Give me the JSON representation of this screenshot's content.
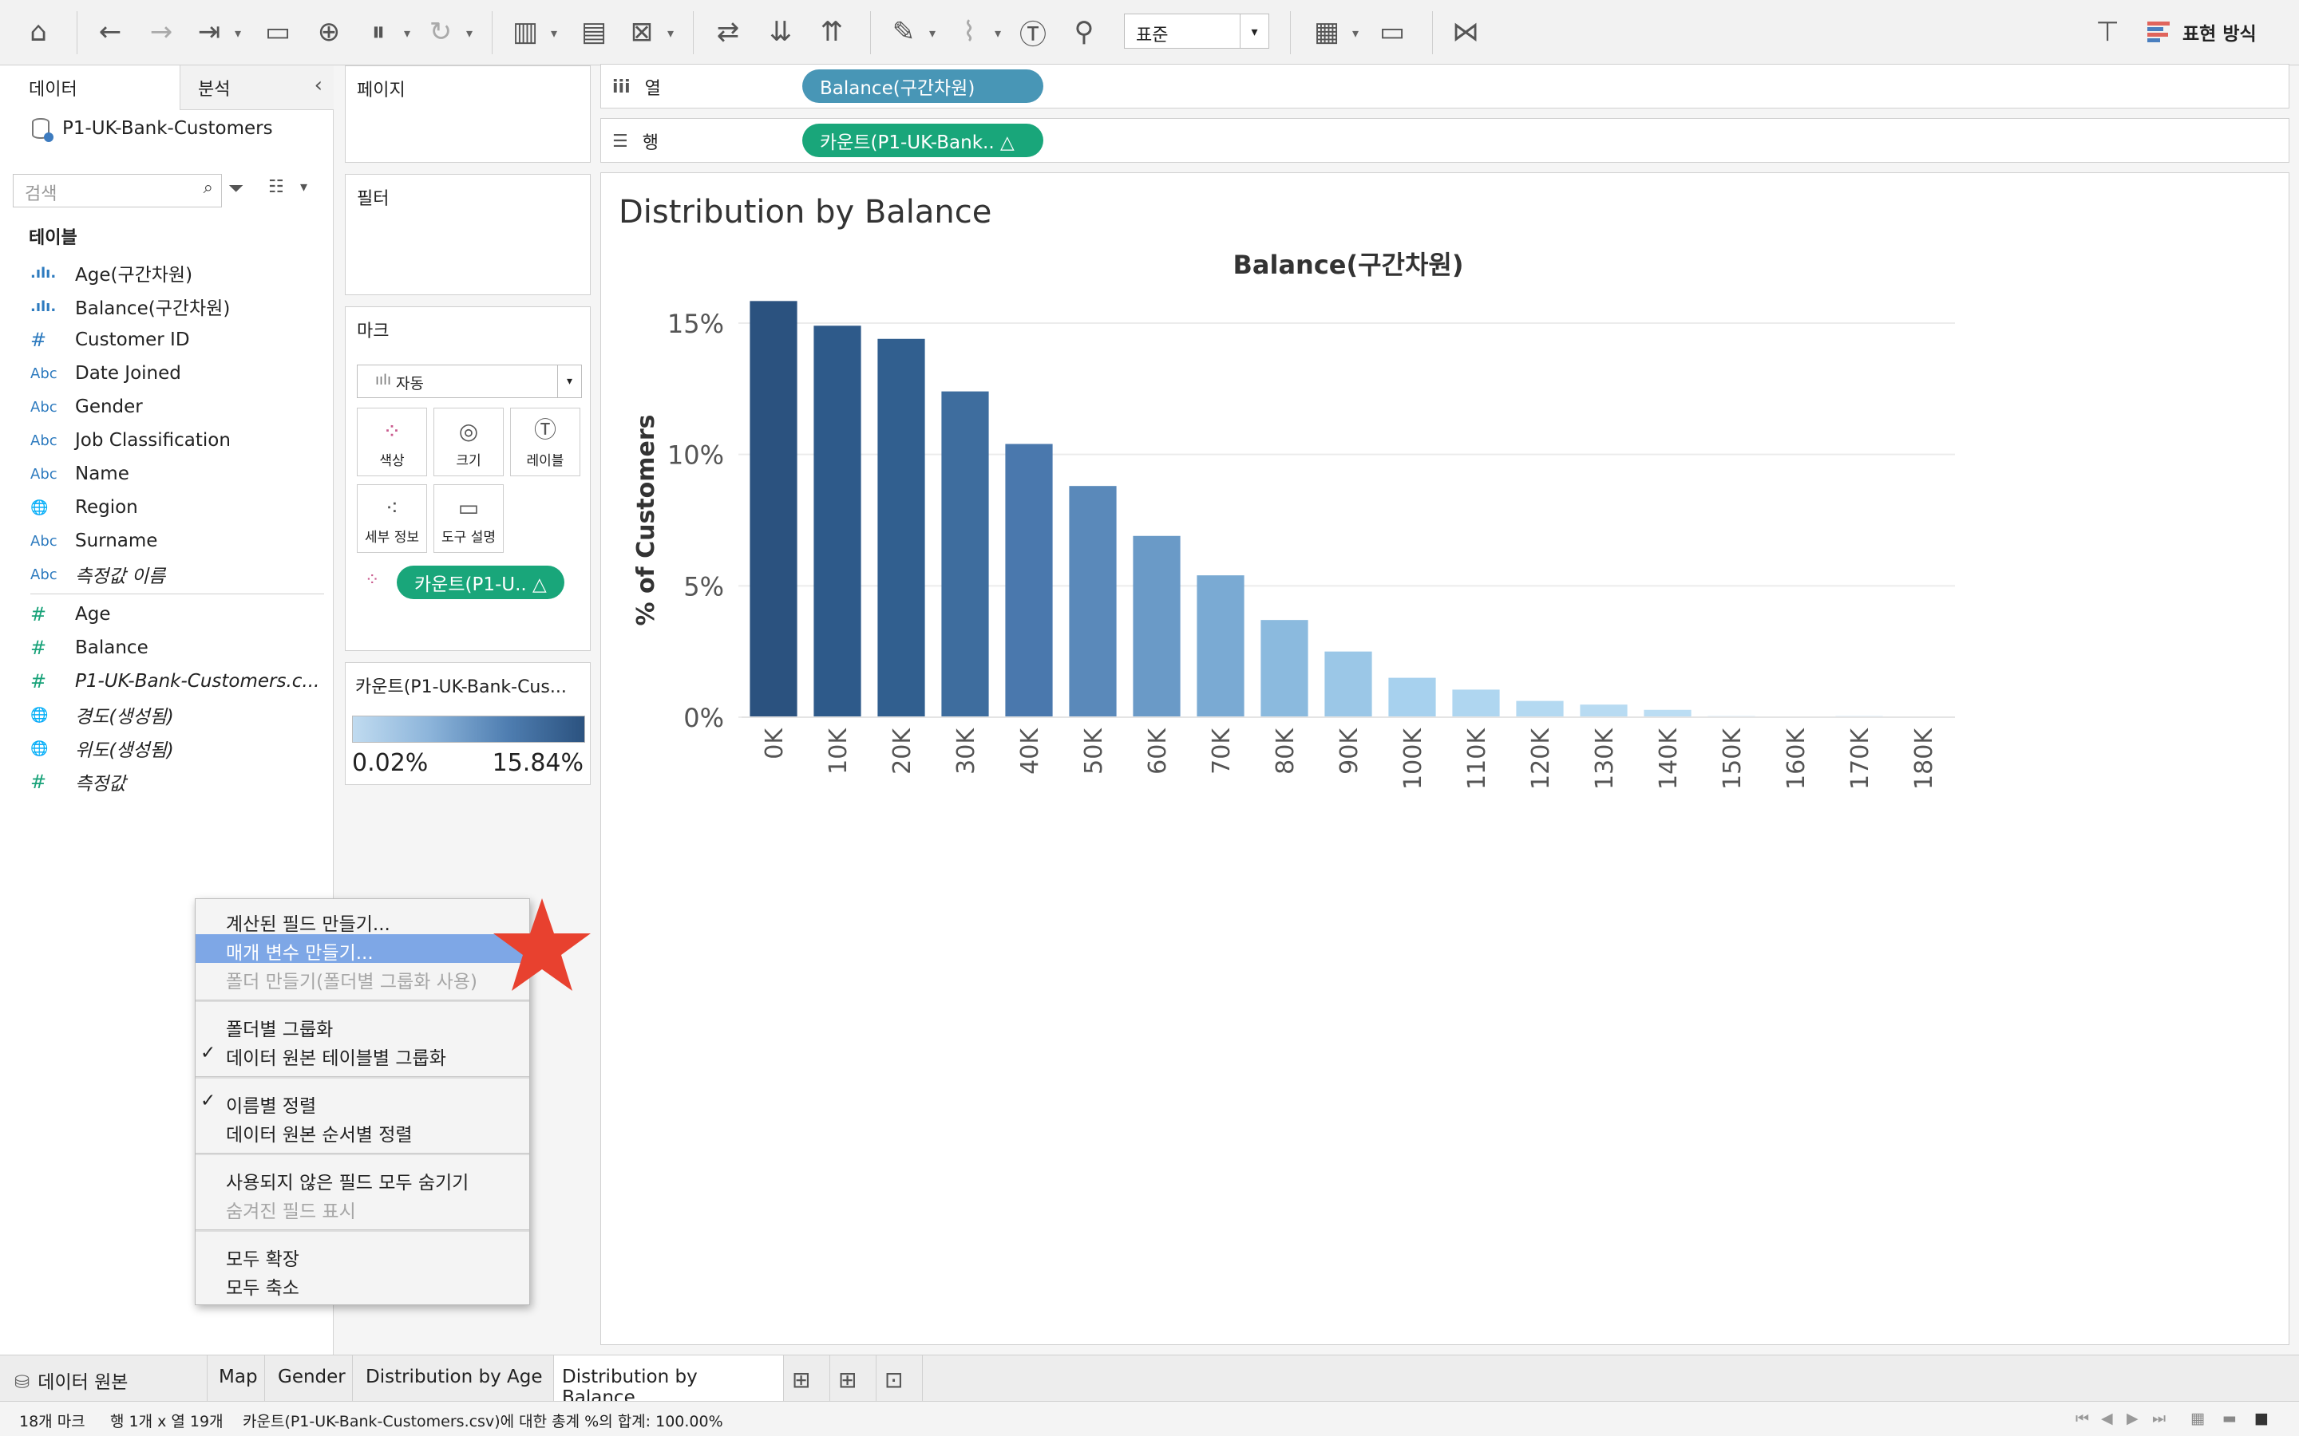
{
  "toolbar": {
    "format_select": "표준",
    "show_me": "표현 방식"
  },
  "left_pane": {
    "tab_data": "데이터",
    "tab_analysis": "분석",
    "datasource": "P1-UK-Bank-Customers",
    "search_placeholder": "검색",
    "tables_header": "테이블",
    "fields": [
      {
        "label": "Age(구간차원)"
      },
      {
        "label": "Balance(구간차원)"
      },
      {
        "label": "Customer ID"
      },
      {
        "label": "Date Joined"
      },
      {
        "label": "Gender"
      },
      {
        "label": "Job Classification"
      },
      {
        "label": "Name"
      },
      {
        "label": "Region"
      },
      {
        "label": "Surname"
      },
      {
        "label": "측정값 이름"
      },
      {
        "label": "Age"
      },
      {
        "label": "Balance"
      },
      {
        "label": "P1-UK-Bank-Customers.c..."
      },
      {
        "label": "경도(생성됨)"
      },
      {
        "label": "위도(생성됨)"
      },
      {
        "label": "측정값"
      }
    ],
    "field_icons": {
      "abc": "Abc",
      "hash": "#",
      "bar": ".ılı.",
      "globe": "🌐"
    }
  },
  "cards": {
    "pages": "페이지",
    "filters": "필터",
    "marks": "마크",
    "mark_type": "자동",
    "mark_buttons": [
      "색상",
      "크기",
      "레이블",
      "세부 정보",
      "도구 설명"
    ],
    "marks_pill": "카운트(P1-U..  △",
    "legend_title": "카운트(P1-UK-Bank-Cus...",
    "legend_min": "0.02%",
    "legend_max": "15.84%"
  },
  "shelves": {
    "columns_label": "열",
    "columns_pill": "Balance(구간차원)",
    "rows_label": "행",
    "rows_pill": "카운트(P1-UK-Bank..  △"
  },
  "sheet_title": "Distribution by Balance",
  "chart_data": {
    "type": "bar",
    "title": "Balance(구간차원)",
    "ylabel": "% of Customers",
    "xlabel": "",
    "ylim": [
      0,
      15
    ],
    "yticks": [
      "0%",
      "5%",
      "10%",
      "15%"
    ],
    "categories": [
      "0K",
      "10K",
      "20K",
      "30K",
      "40K",
      "50K",
      "60K",
      "70K",
      "80K",
      "90K",
      "100K",
      "110K",
      "120K",
      "130K",
      "140K",
      "150K",
      "160K",
      "170K",
      "180K"
    ],
    "values": [
      15.84,
      14.9,
      14.4,
      12.4,
      10.4,
      8.8,
      6.9,
      5.4,
      3.7,
      2.5,
      1.5,
      1.05,
      0.62,
      0.48,
      0.28,
      0.04,
      0.03,
      0.04,
      0.02
    ],
    "colors": [
      "#2b527f",
      "#2e5a8a",
      "#315f8f",
      "#3e6d9e",
      "#4a78ad",
      "#5a89ba",
      "#6a9ac7",
      "#7aaad3",
      "#8bbade",
      "#9bc7e7",
      "#a7d1ee",
      "#afd6f0",
      "#b4d9f1",
      "#b8dbf2",
      "#bbddf3",
      "#bddef3",
      "#bddef3",
      "#bddef3",
      "#bddef3"
    ]
  },
  "context_menu": {
    "items": [
      "계산된 필드 만들기...",
      "매개 변수 만들기...",
      "폴더 만들기(폴더별 그룹화 사용)",
      "폴더별 그룹화",
      "데이터 원본 테이블별 그룹화",
      "이름별 정렬",
      "데이터 원본 순서별 정렬",
      "사용되지 않은 필드 모두 숨기기",
      "숨겨진 필드 표시",
      "모두 확장",
      "모두 축소"
    ],
    "checkmark": "✓"
  },
  "sheet_tabs": [
    "데이터 원본",
    "Map",
    "Gender",
    "Distribution by Age",
    "Distribution by Balance"
  ],
  "status": {
    "marks": "18개 마크",
    "dims": "행 1개 x 열 19개",
    "sum": "카운트(P1-UK-Bank-Customers.csv)에 대한 총계 %의 합계: 100.00%"
  }
}
